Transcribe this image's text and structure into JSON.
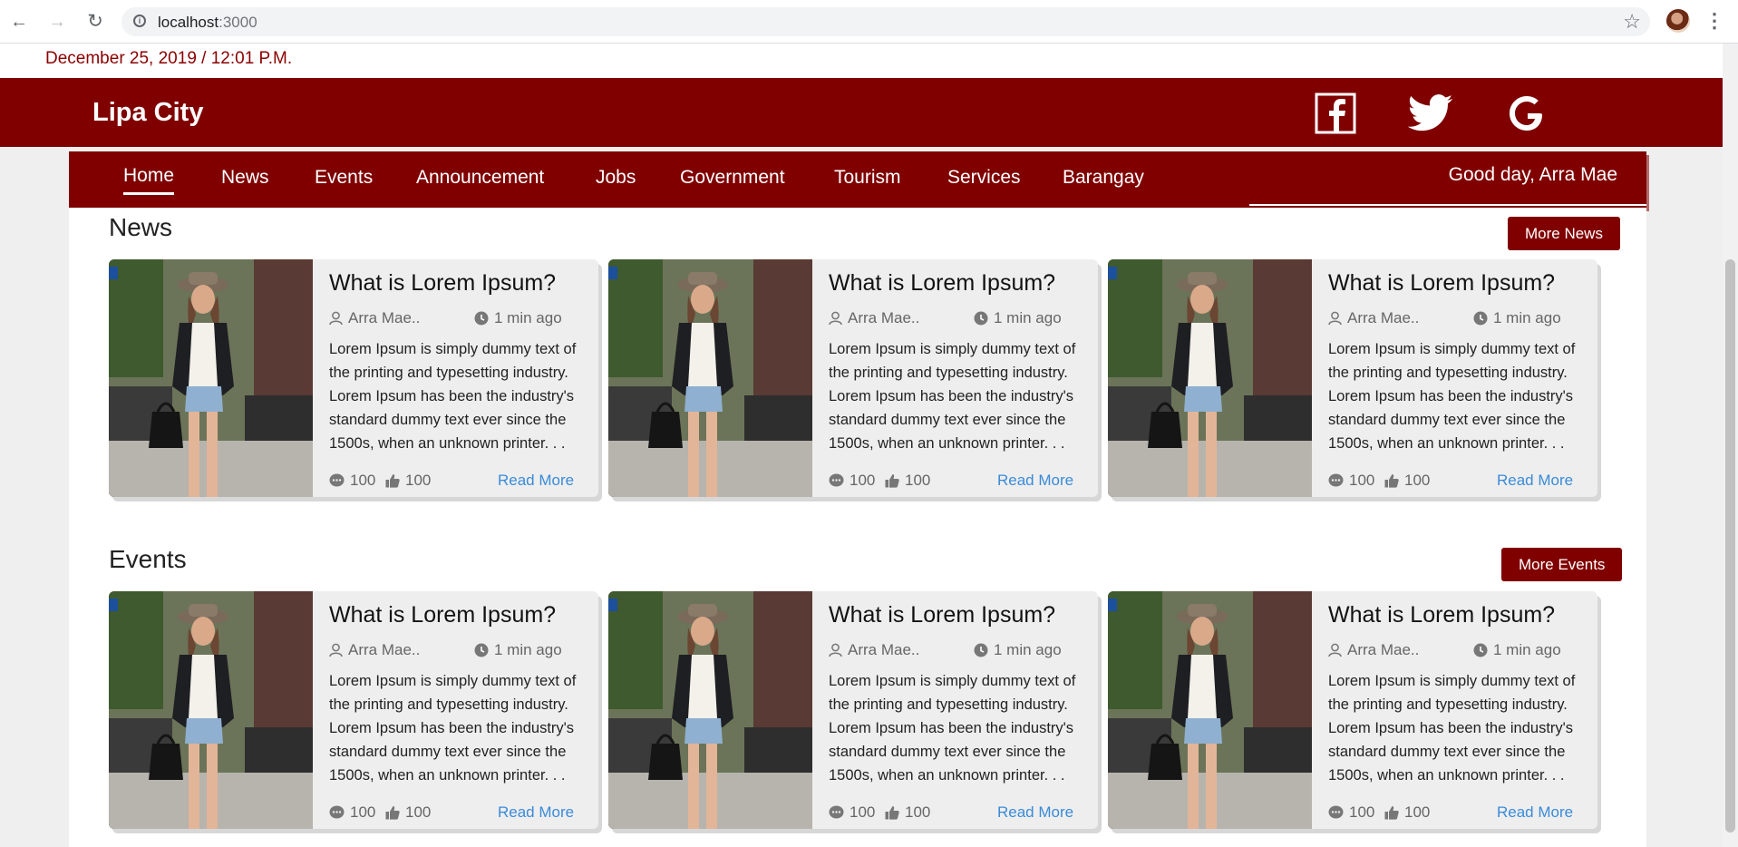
{
  "browser": {
    "url_host": "localhost",
    "url_port": ":3000"
  },
  "date_text": "December 25, 2019 / 12:01 P.M.",
  "site": {
    "title": "Lipa City",
    "social": [
      "facebook-icon",
      "twitter-icon",
      "google-icon"
    ]
  },
  "nav": {
    "items": [
      "Home",
      "News",
      "Events",
      "Announcement",
      "Jobs",
      "Government",
      "Tourism",
      "Services",
      "Barangay"
    ],
    "active": "Home",
    "greeting": "Good day, Arra Mae"
  },
  "news": {
    "title": "News",
    "more_label": "More News",
    "cards": [
      {
        "title": "What is Lorem Ipsum?",
        "author": "Arra Mae..",
        "time": "1 min ago",
        "text": "Lorem Ipsum is simply dummy text of the printing and typesetting industry. Lorem Ipsum has been the industry's standard dummy text ever since the 1500s, when an unknown printer. . .",
        "comments": "100",
        "likes": "100",
        "read_more": "Read More"
      },
      {
        "title": "What is Lorem Ipsum?",
        "author": "Arra Mae..",
        "time": "1 min ago",
        "text": "Lorem Ipsum is simply dummy text of the printing and typesetting industry. Lorem Ipsum has been the industry's standard dummy text ever since the 1500s, when an unknown printer. . .",
        "comments": "100",
        "likes": "100",
        "read_more": "Read More"
      },
      {
        "title": "What is Lorem Ipsum?",
        "author": "Arra Mae..",
        "time": "1 min ago",
        "text": "Lorem Ipsum is simply dummy text of the printing and typesetting industry. Lorem Ipsum has been the industry's standard dummy text ever since the 1500s, when an unknown printer. . .",
        "comments": "100",
        "likes": "100",
        "read_more": "Read More"
      }
    ]
  },
  "events": {
    "title": "Events",
    "more_label": "More Events",
    "cards": [
      {
        "title": "What is Lorem Ipsum?",
        "author": "Arra Mae..",
        "time": "1 min ago",
        "text": "Lorem Ipsum is simply dummy text of the printing and typesetting industry. Lorem Ipsum has been the industry's standard dummy text ever since the 1500s, when an unknown printer. . .",
        "comments": "100",
        "likes": "100",
        "read_more": "Read More"
      },
      {
        "title": "What is Lorem Ipsum?",
        "author": "Arra Mae..",
        "time": "1 min ago",
        "text": "Lorem Ipsum is simply dummy text of the printing and typesetting industry. Lorem Ipsum has been the industry's standard dummy text ever since the 1500s, when an unknown printer. . .",
        "comments": "100",
        "likes": "100",
        "read_more": "Read More"
      },
      {
        "title": "What is Lorem Ipsum?",
        "author": "Arra Mae..",
        "time": "1 min ago",
        "text": "Lorem Ipsum is simply dummy text of the printing and typesetting industry. Lorem Ipsum has been the industry's standard dummy text ever since the 1500s, when an unknown printer. . .",
        "comments": "100",
        "likes": "100",
        "read_more": "Read More"
      }
    ]
  },
  "colors": {
    "brand": "#800000",
    "link": "#3a8bd8"
  }
}
